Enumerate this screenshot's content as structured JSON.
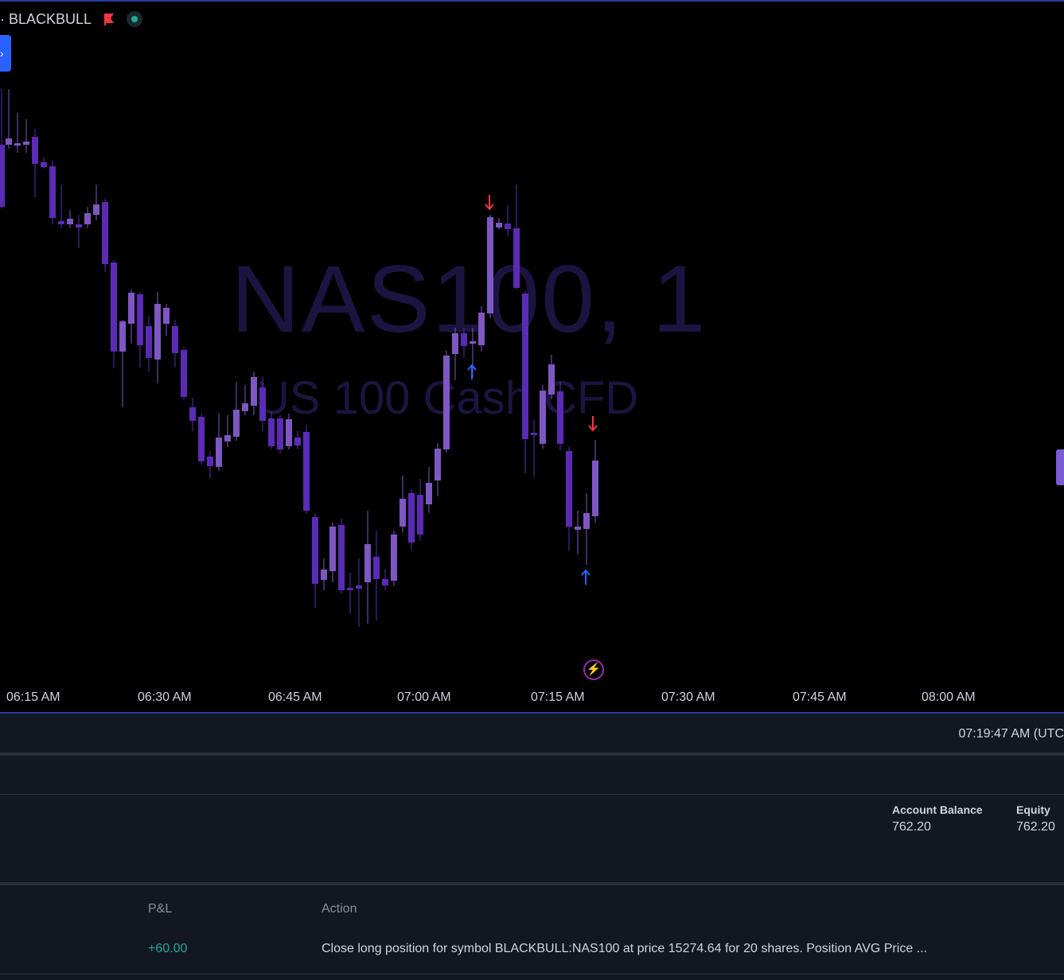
{
  "header": {
    "symbol_label": "· BLACKBULL",
    "flag_icon": "flag-icon",
    "status_icon": "market-open-dot-icon",
    "colors": {
      "flag": "#f23645",
      "status": "#22ab94"
    }
  },
  "chart": {
    "watermark_symbol": "NAS100, 1",
    "watermark_description": "US 100 Cash CFD",
    "time_axis": [
      "06:15 AM",
      "06:30 AM",
      "06:45 AM",
      "07:00 AM",
      "07:15 AM",
      "07:30 AM",
      "07:45 AM",
      "08:00 AM"
    ],
    "colors": {
      "up": "#7e57c2",
      "down": "#5b2bb5",
      "buy_arrow": "#2962ff",
      "sell_arrow": "#f23645"
    },
    "events_icon": "lightning-icon"
  },
  "panel": {
    "clock": "07:19:47 AM (UTC",
    "account_balance_label": "Account Balance",
    "account_balance_value": "762.20",
    "equity_label": "Equity",
    "equity_value": "762.20"
  },
  "trades": {
    "columns": {
      "pnl": "P&L",
      "action": "Action"
    },
    "rows": [
      {
        "pnl": "+60.00",
        "action": "Close long position for symbol BLACKBULL:NAS100 at price 15274.64 for 20 shares. Position AVG Price ..."
      }
    ]
  }
}
